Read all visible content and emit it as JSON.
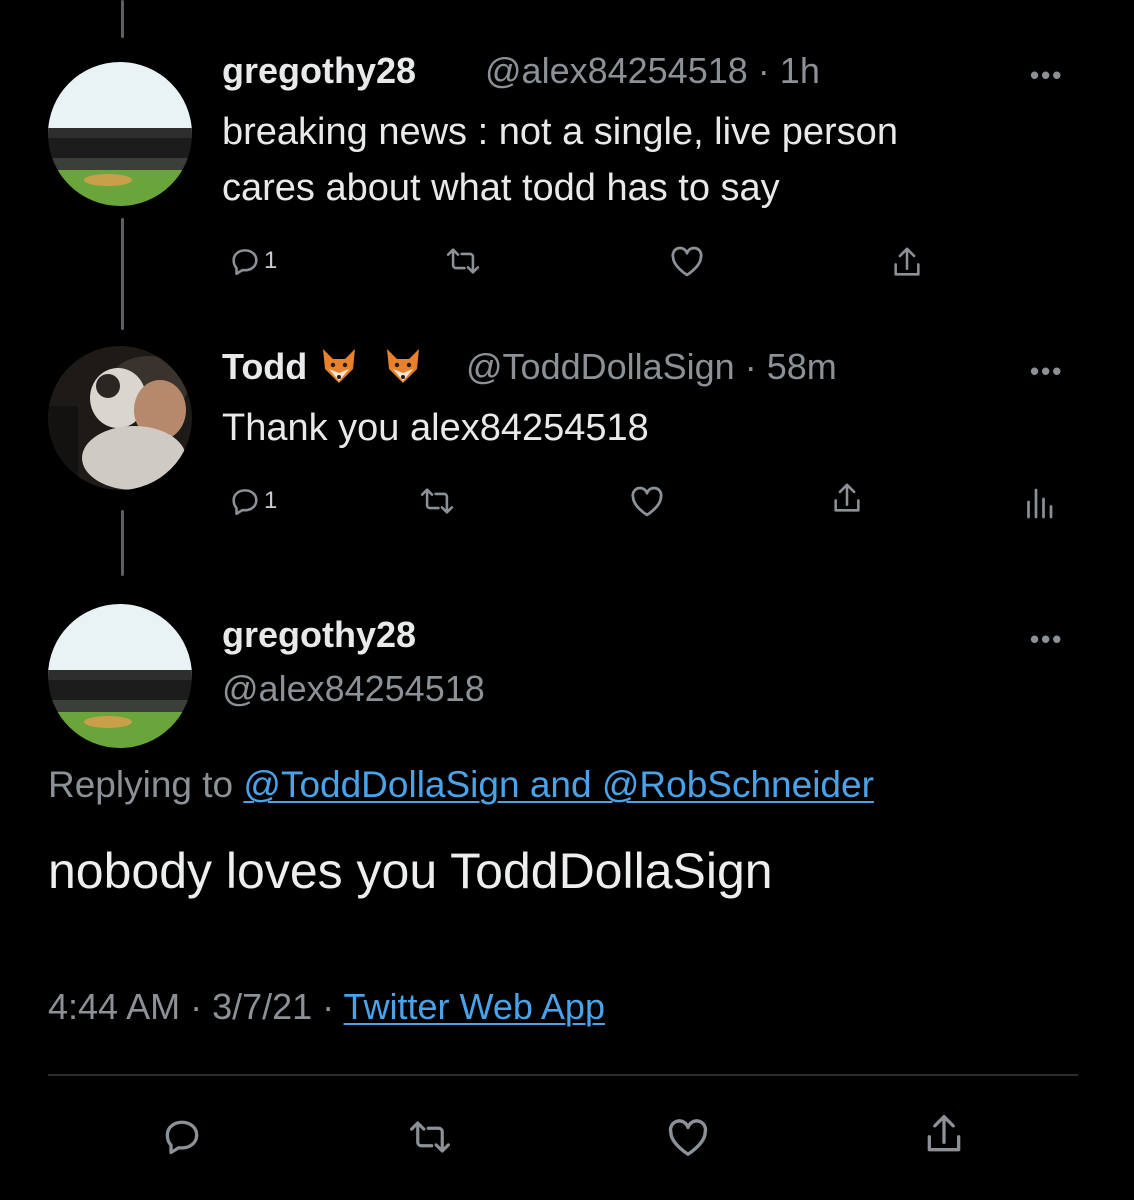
{
  "tweet1": {
    "display_name": "gregothy28",
    "handle": "@alex84254518",
    "time": "1h",
    "text_line1": "breaking news : not a single, live person",
    "text_line2": "cares about what todd has to say",
    "reply_count": "1",
    "more": "•••"
  },
  "tweet2": {
    "display_name": "Todd",
    "handle": "@ToddDollaSign",
    "time": "58m",
    "text": "Thank you alex84254518",
    "reply_count": "1",
    "more": "•••"
  },
  "main_tweet": {
    "display_name": "gregothy28",
    "handle": "@alex84254518",
    "replying_label": "Replying to",
    "replying_to": "@ToddDollaSign and @RobSchneider",
    "text": "nobody loves you ToddDollaSign",
    "timestamp": "4:44 AM · 3/7/21 · ",
    "source": "Twitter Web App",
    "more": "•••"
  },
  "separator": "·",
  "colors": {
    "background": "#000000",
    "link": "#4aa3e8",
    "muted": "#8b9196",
    "fox": "#e8812b"
  },
  "icons": [
    "reply-icon",
    "retweet-icon",
    "like-icon",
    "share-icon",
    "analytics-icon",
    "fox-emoji-icon"
  ]
}
